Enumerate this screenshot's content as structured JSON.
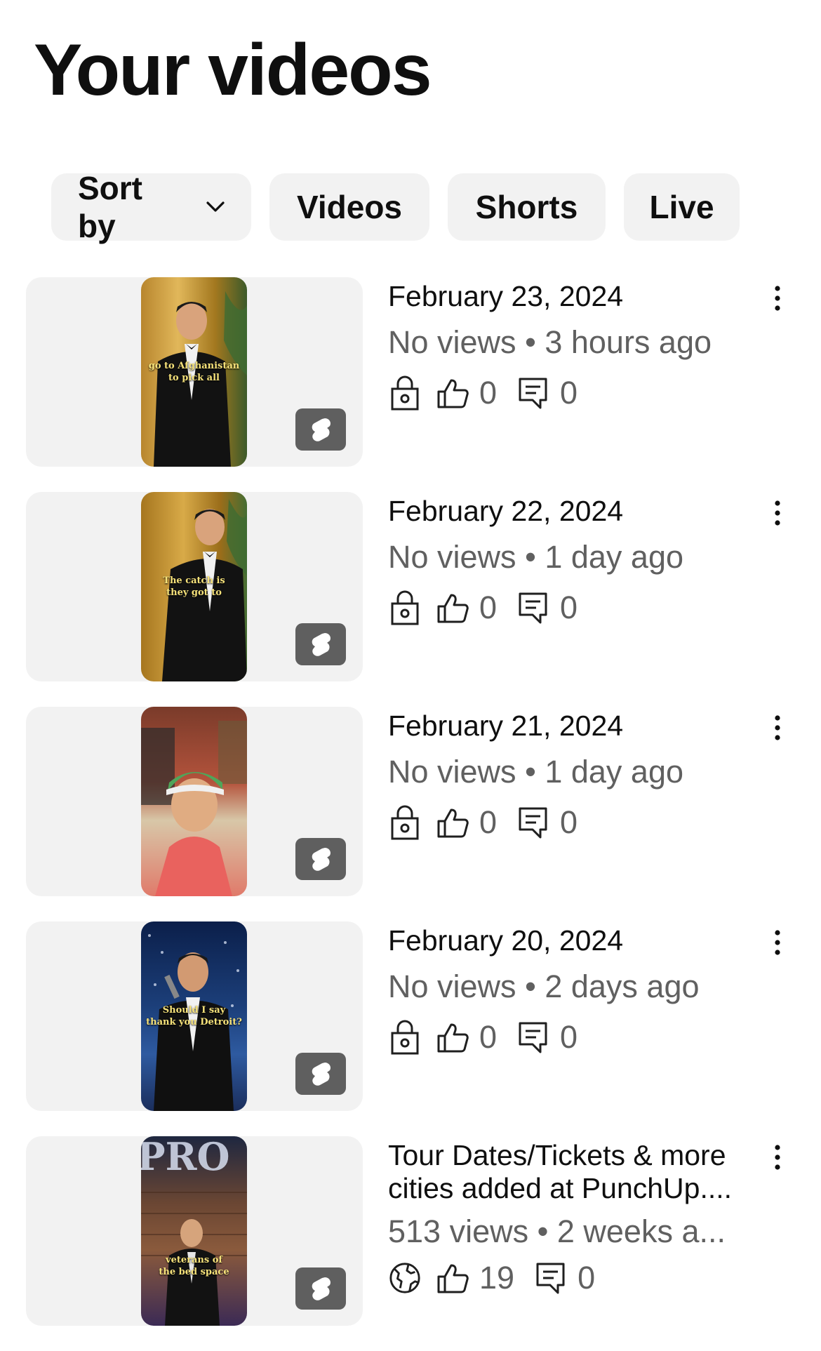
{
  "page": {
    "title": "Your videos"
  },
  "filters": {
    "sort_label": "Sort by",
    "chips": [
      "Videos",
      "Shorts",
      "Live"
    ]
  },
  "videos": [
    {
      "title": "February 23, 2024",
      "views": "No views",
      "age": "3 hours ago",
      "visibility_icon": "lock-icon",
      "likes": "0",
      "comments": "0",
      "overlay_text": [
        "go to Afghanistan",
        "to pick all"
      ]
    },
    {
      "title": "February 22, 2024",
      "views": "No views",
      "age": "1 day ago",
      "visibility_icon": "lock-icon",
      "likes": "0",
      "comments": "0",
      "overlay_text": [
        "The catch is",
        "they got to"
      ]
    },
    {
      "title": "February 21, 2024",
      "views": "No views",
      "age": "1 day ago",
      "visibility_icon": "lock-icon",
      "likes": "0",
      "comments": "0",
      "overlay_text": []
    },
    {
      "title": "February 20, 2024",
      "views": "No views",
      "age": "2 days ago",
      "visibility_icon": "lock-icon",
      "likes": "0",
      "comments": "0",
      "overlay_text": [
        "Should I say",
        "thank you Detroit?"
      ]
    },
    {
      "title": "Tour Dates/Tickets & more cities added at PunchUp....",
      "views": "513 views",
      "age": "2 weeks a...",
      "visibility_icon": "globe-icon",
      "likes": "19",
      "comments": "0",
      "overlay_text": [
        "veterans of",
        "the bed space"
      ]
    }
  ],
  "colors": {
    "chip_bg": "#f2f2f2",
    "secondary_text": "#606060",
    "badge_bg": "#5f5f5f"
  }
}
